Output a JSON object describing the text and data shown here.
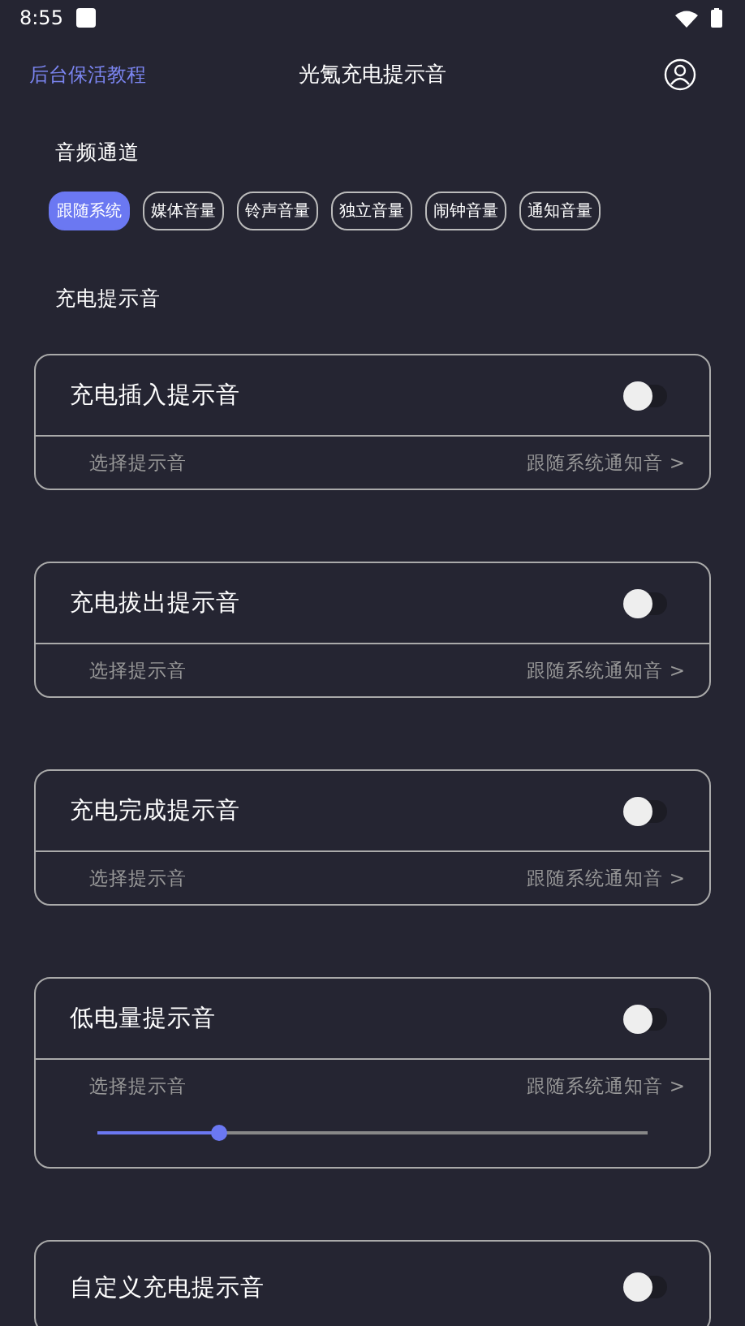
{
  "status_bar": {
    "time": "8:55"
  },
  "header": {
    "link": "后台保活教程",
    "title": "光氪充电提示音"
  },
  "audio_channel": {
    "label": "音频通道",
    "chips": [
      {
        "label": "跟随系统",
        "selected": true
      },
      {
        "label": "媒体音量",
        "selected": false
      },
      {
        "label": "铃声音量",
        "selected": false
      },
      {
        "label": "独立音量",
        "selected": false
      },
      {
        "label": "闹钟音量",
        "selected": false
      },
      {
        "label": "通知音量",
        "selected": false
      }
    ]
  },
  "section_label": "充电提示音",
  "cards": [
    {
      "kind": "sound",
      "title": "充电插入提示音",
      "on": false,
      "select_label": "选择提示音",
      "select_value": "跟随系统通知音 >"
    },
    {
      "kind": "sound",
      "title": "充电拔出提示音",
      "on": false,
      "select_label": "选择提示音",
      "select_value": "跟随系统通知音 >"
    },
    {
      "kind": "sound",
      "title": "充电完成提示音",
      "on": false,
      "select_label": "选择提示音",
      "select_value": "跟随系统通知音 >"
    },
    {
      "kind": "level",
      "title": "低电量提示音",
      "on": false,
      "select_label": "选择提示音",
      "select_value": "跟随系统通知音 >",
      "level": 0.22
    },
    {
      "kind": "title",
      "title": "自定义充电提示音",
      "on": false
    }
  ]
}
